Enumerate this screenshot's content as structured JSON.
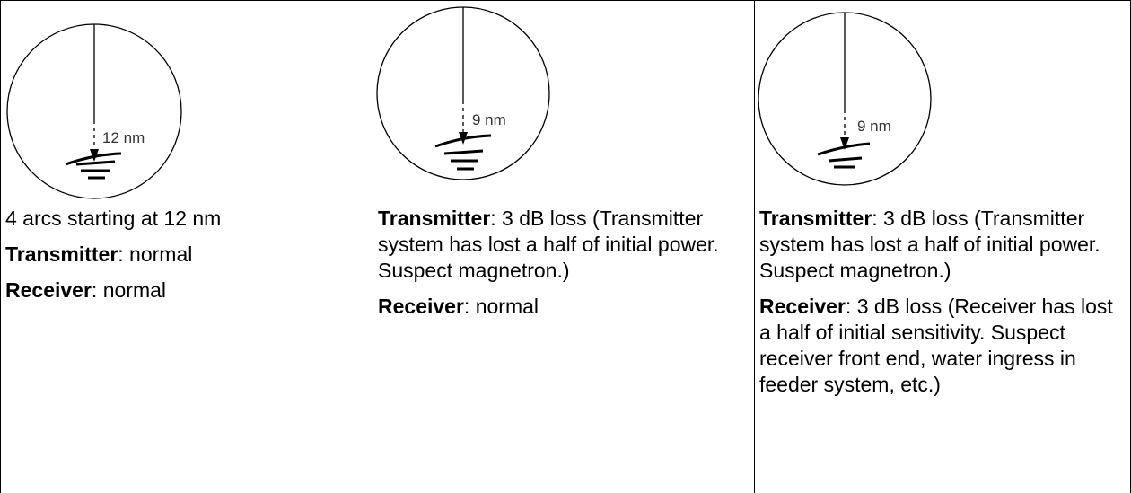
{
  "columns": [
    {
      "distance_label": "12 nm",
      "lines": [
        {
          "bold": "",
          "text": "4 arcs starting at 12 nm"
        },
        {
          "bold": "Transmitter",
          "text": ": normal"
        },
        {
          "bold": "Receiver",
          "text": ": normal"
        }
      ]
    },
    {
      "distance_label": "9 nm",
      "lines": [
        {
          "bold": "Transmitter",
          "text": ": 3 dB loss (Transmitter system has lost a half of initial power. Suspect magnetron.)"
        },
        {
          "bold": "Receiver",
          "text": ": normal"
        }
      ]
    },
    {
      "distance_label": "9 nm",
      "lines": [
        {
          "bold": "Transmitter",
          "text": ": 3 dB loss (Transmitter system has lost a half of initial power. Suspect magnetron.)"
        },
        {
          "bold": "Receiver",
          "text": ": 3 dB loss (Receiver has lost a half of initial sensitivity. Suspect receiver front end, water ingress in feeder system, etc.)"
        }
      ]
    }
  ]
}
